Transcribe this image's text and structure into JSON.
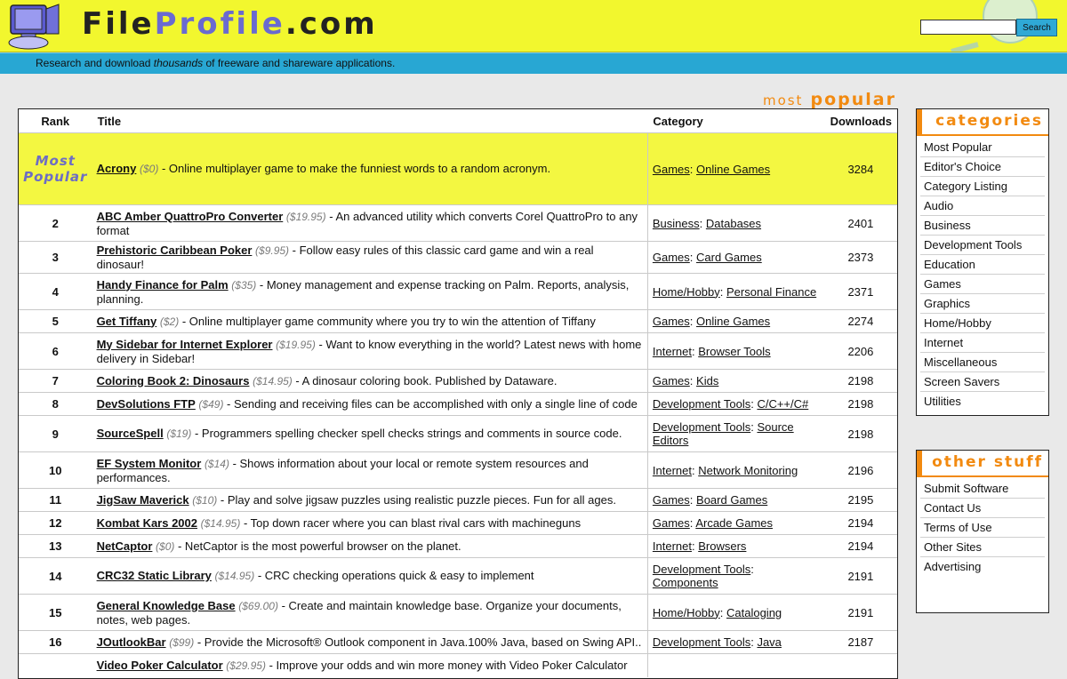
{
  "header": {
    "brand_part1": "File",
    "brand_part2": "Profile",
    "brand_part3": ".com",
    "tagline_before": "Research and download ",
    "tagline_em": "thousands",
    "tagline_after": " of freeware and shareware applications.",
    "search_button": "Search",
    "search_value": ""
  },
  "section": {
    "title_light": "most",
    "title_bold": "popular"
  },
  "table": {
    "headers": {
      "rank": "Rank",
      "title": "Title",
      "category": "Category",
      "downloads": "Downloads"
    },
    "featured": {
      "rank_line1": "Most",
      "rank_line2": "Popular",
      "name": "Acrony",
      "price": "($0)",
      "desc": " - Online multiplayer game to make the funniest words to a random acronym.",
      "cat": "Games",
      "subcat": "Online Games",
      "downloads": "3284"
    },
    "rows": [
      {
        "rank": "2",
        "name": "ABC Amber QuattroPro Converter",
        "price": "($19.95)",
        "desc": " - An advanced utility which converts Corel QuattroPro to any format",
        "cat": "Business",
        "subcat": "Databases",
        "downloads": "2401"
      },
      {
        "rank": "3",
        "name": "Prehistoric Caribbean Poker",
        "price": "($9.95)",
        "desc": " - Follow easy rules of this classic card game and win a real dinosaur!",
        "cat": "Games",
        "subcat": "Card Games",
        "downloads": "2373"
      },
      {
        "rank": "4",
        "name": "Handy Finance for Palm",
        "price": "($35)",
        "desc": " - Money management and expense tracking on Palm. Reports, analysis, planning.",
        "cat": "Home/Hobby",
        "subcat": "Personal Finance",
        "downloads": "2371"
      },
      {
        "rank": "5",
        "name": "Get Tiffany",
        "price": "($2)",
        "desc": " - Online multiplayer game community where you try to win the attention of Tiffany",
        "cat": "Games",
        "subcat": "Online Games",
        "downloads": "2274"
      },
      {
        "rank": "6",
        "name": "My Sidebar for Internet Explorer",
        "price": "($19.95)",
        "desc": " - Want to know everything in the world? Latest news with home delivery in Sidebar!",
        "cat": "Internet",
        "subcat": "Browser Tools",
        "downloads": "2206"
      },
      {
        "rank": "7",
        "name": "Coloring Book 2: Dinosaurs",
        "price": "($14.95)",
        "desc": " - A dinosaur coloring book. Published by Dataware.",
        "cat": "Games",
        "subcat": "Kids",
        "downloads": "2198"
      },
      {
        "rank": "8",
        "name": "DevSolutions FTP",
        "price": "($49)",
        "desc": " - Sending and receiving files can be accomplished with only a single line of code",
        "cat": "Development Tools",
        "subcat": "C/C++/C#",
        "downloads": "2198"
      },
      {
        "rank": "9",
        "name": "SourceSpell",
        "price": "($19)",
        "desc": " - Programmers spelling checker spell checks strings and comments in source code.",
        "cat": "Development Tools",
        "subcat": "Source Editors",
        "downloads": "2198"
      },
      {
        "rank": "10",
        "name": "EF System Monitor",
        "price": "($14)",
        "desc": " - Shows information about your local or remote system resources and performances.",
        "cat": "Internet",
        "subcat": "Network Monitoring",
        "downloads": "2196"
      },
      {
        "rank": "11",
        "name": "JigSaw Maverick",
        "price": "($10)",
        "desc": " - Play and solve jigsaw puzzles using realistic puzzle pieces. Fun for all ages.",
        "cat": "Games",
        "subcat": "Board Games",
        "downloads": "2195"
      },
      {
        "rank": "12",
        "name": "Kombat Kars 2002",
        "price": "($14.95)",
        "desc": " - Top down racer where you can blast rival cars with machineguns",
        "cat": "Games",
        "subcat": "Arcade Games",
        "downloads": "2194"
      },
      {
        "rank": "13",
        "name": "NetCaptor",
        "price": "($0)",
        "desc": " - NetCaptor is the most powerful browser on the planet.",
        "cat": "Internet",
        "subcat": "Browsers",
        "downloads": "2194"
      },
      {
        "rank": "14",
        "name": "CRC32 Static Library",
        "price": "($14.95)",
        "desc": " - CRC checking operations quick & easy to implement",
        "cat": "Development Tools",
        "subcat": "Components",
        "downloads": "2191"
      },
      {
        "rank": "15",
        "name": "General Knowledge Base",
        "price": "($69.00)",
        "desc": " - Create and maintain knowledge base. Organize your documents, notes, web pages.",
        "cat": "Home/Hobby",
        "subcat": "Cataloging",
        "downloads": "2191"
      },
      {
        "rank": "16",
        "name": "JOutlookBar",
        "price": "($99)",
        "desc": " - Provide the Microsoft® Outlook component in Java.100% Java, based on Swing API..",
        "cat": "Development Tools",
        "subcat": "Java",
        "downloads": "2187"
      },
      {
        "rank": "",
        "name": "Video Poker Calculator",
        "price": "($29.95)",
        "desc": " - Improve your odds and win more money with Video Poker Calculator",
        "cat": "",
        "subcat": "",
        "downloads": ""
      }
    ]
  },
  "categories": {
    "title": "categories",
    "items": [
      "Most Popular",
      "Editor's Choice",
      "Category Listing",
      "Audio",
      "Business",
      "Development Tools",
      "Education",
      "Games",
      "Graphics",
      "Home/Hobby",
      "Internet",
      "Miscellaneous",
      "Screen Savers",
      "Utilities"
    ]
  },
  "other": {
    "title": "other stuff",
    "items": [
      "Submit Software",
      "Contact Us",
      "Terms of Use",
      "Other Sites",
      "Advertising"
    ]
  }
}
